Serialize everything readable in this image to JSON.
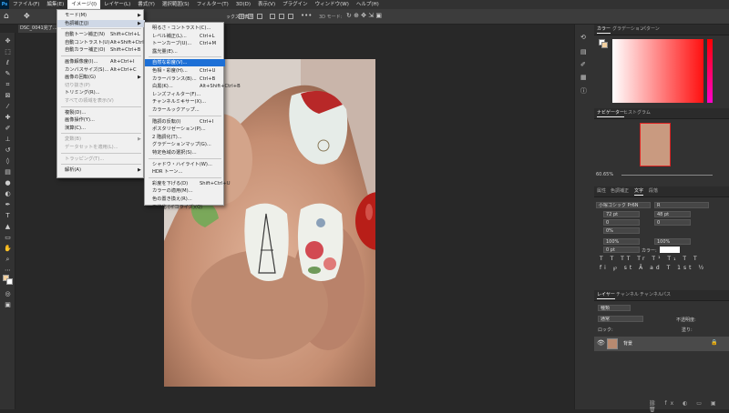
{
  "app": {
    "logo": "Ps"
  },
  "menubar": [
    "ファイル(F)",
    "編集(E)",
    "イメージ(I)",
    "レイヤー(L)",
    "書式(Y)",
    "選択範囲(S)",
    "フィルター(T)",
    "3D(D)",
    "表示(V)",
    "プラグイン",
    "ウィンドウ(W)",
    "ヘルプ(H)"
  ],
  "optionsbar": {
    "show_transform": "ックスを表示",
    "mode3d": "3D モード:"
  },
  "document": {
    "tab": "DSC_0041完了..."
  },
  "image_menu": {
    "items": [
      {
        "label": "モード(M)",
        "shortcut": "",
        "submenu": true
      },
      {
        "label": "色調補正(J)",
        "shortcut": "",
        "submenu": true,
        "active": true
      },
      {
        "label": "自動トーン補正(N)",
        "shortcut": "Shift+Ctrl+L"
      },
      {
        "label": "自動コントラスト(U)",
        "shortcut": "Alt+Shift+Ctrl+L"
      },
      {
        "label": "自動カラー補正(O)",
        "shortcut": "Shift+Ctrl+B"
      },
      {
        "label": "画像解像度(I)...",
        "shortcut": "Alt+Ctrl+I"
      },
      {
        "label": "カンバスサイズ(S)...",
        "shortcut": "Alt+Ctrl+C"
      },
      {
        "label": "画像の回転(G)",
        "shortcut": "",
        "submenu": true
      },
      {
        "label": "切り抜き(P)",
        "shortcut": "",
        "disabled": true
      },
      {
        "label": "トリミング(R)...",
        "shortcut": ""
      },
      {
        "label": "すべての領域を表示(V)",
        "shortcut": "",
        "disabled": true
      },
      {
        "label": "複製(D)...",
        "shortcut": ""
      },
      {
        "label": "画像操作(Y)...",
        "shortcut": ""
      },
      {
        "label": "演算(C)...",
        "shortcut": ""
      },
      {
        "label": "変数(B)",
        "shortcut": "",
        "submenu": true,
        "disabled": true
      },
      {
        "label": "データセットを適用(L)...",
        "shortcut": "",
        "disabled": true
      },
      {
        "label": "トラッピング(T)...",
        "shortcut": "",
        "disabled": true
      },
      {
        "label": "解析(A)",
        "shortcut": "",
        "submenu": true
      }
    ]
  },
  "adjust_menu": {
    "items": [
      {
        "label": "明るさ・コントラスト(C)...",
        "shortcut": ""
      },
      {
        "label": "レベル補正(L)...",
        "shortcut": "Ctrl+L"
      },
      {
        "label": "トーンカーブ(U)...",
        "shortcut": "Ctrl+M"
      },
      {
        "label": "露光量(E)...",
        "shortcut": ""
      },
      {
        "label": "自然な彩度(V)...",
        "shortcut": "",
        "highlight": true
      },
      {
        "label": "色相・彩度(H)...",
        "shortcut": "Ctrl+U"
      },
      {
        "label": "カラーバランス(B)...",
        "shortcut": "Ctrl+B"
      },
      {
        "label": "白黒(K)...",
        "shortcut": "Alt+Shift+Ctrl+B"
      },
      {
        "label": "レンズフィルター(F)...",
        "shortcut": ""
      },
      {
        "label": "チャンネルミキサー(X)...",
        "shortcut": ""
      },
      {
        "label": "カラールックアップ...",
        "shortcut": ""
      },
      {
        "label": "階調の反転(I)",
        "shortcut": "Ctrl+I"
      },
      {
        "label": "ポスタリゼーション(P)...",
        "shortcut": ""
      },
      {
        "label": "2 階調化(T)...",
        "shortcut": ""
      },
      {
        "label": "グラデーションマップ(G)...",
        "shortcut": ""
      },
      {
        "label": "特定色域の選択(S)...",
        "shortcut": ""
      },
      {
        "label": "シャドウ・ハイライト(W)...",
        "shortcut": ""
      },
      {
        "label": "HDR トーン...",
        "shortcut": ""
      },
      {
        "label": "彩度を下げる(D)",
        "shortcut": "Shift+Ctrl+U"
      },
      {
        "label": "カラーの適用(M)...",
        "shortcut": ""
      },
      {
        "label": "色の置き換え(R)...",
        "shortcut": ""
      },
      {
        "label": "平均化 (イコライズ)(Q)",
        "shortcut": ""
      }
    ]
  },
  "panels": {
    "color_tabs": [
      "カラー",
      "グラデーション",
      "パターン"
    ],
    "nav_tabs": [
      "ナビゲーター",
      "ヒストグラム"
    ],
    "zoom": "60.65%",
    "props_tabs": [
      "属性",
      "色調補正",
      "文字",
      "段落"
    ],
    "font_family": "小塚ゴシック Pr6N",
    "font_style": "R",
    "font_size": "72 pt",
    "leading": "48 pt",
    "kerning": "0",
    "tracking": "0",
    "tsume": "0%",
    "vscale": "100%",
    "hscale": "100%",
    "baseline": "0 pt",
    "color_label": "カラー:",
    "layers_tabs": [
      "レイヤー",
      "チャンネル",
      "チャンネル",
      "パス"
    ],
    "kind": "種類",
    "blend": "通常",
    "opacity_label": "不透明度:",
    "fill_label": "塗り:",
    "lock_label": "ロック:",
    "layer_name": "背景"
  },
  "colors": {
    "menu_highlight": "#1c6fd6",
    "fg_swatch": "#f2d0a0",
    "bg_swatch": "#ffffff"
  }
}
